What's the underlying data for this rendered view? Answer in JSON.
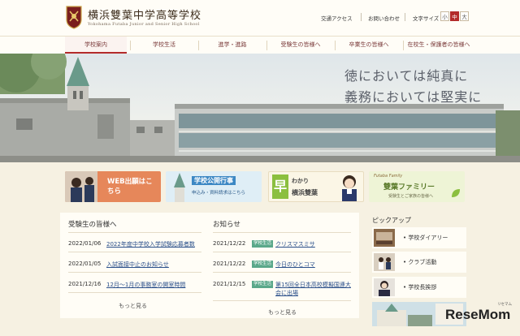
{
  "header": {
    "school_name": "横浜雙葉中学高等学校",
    "school_name_en": "Yokohama Futaba Junior and Senior High School",
    "utility_links": [
      "交通アクセス",
      "お問い合わせ"
    ],
    "font_size_label": "文字サイズ",
    "font_sizes": [
      "小",
      "中",
      "大"
    ],
    "font_size_selected": "中"
  },
  "nav": {
    "items": [
      "学校案内",
      "学校生活",
      "進学・進路",
      "受験生の皆様へ",
      "卒業生の皆様へ",
      "在校生・保護者の皆様へ"
    ],
    "active": "学校案内"
  },
  "hero": {
    "motto_line1": "徳においては純真に",
    "motto_line2": "義務においては堅実に"
  },
  "banners": {
    "web_application": "WEB出願はこちら",
    "school_events": "学校公開行事",
    "school_events_sub": "申込み・資料請求はこちら",
    "easy_futaba_1": "わかり",
    "easy_futaba_2": "横浜雙葉",
    "easy_futaba_big": "早",
    "family": "雙葉ファミリー",
    "family_en": "Futaba Family",
    "family_sub": "受験生とご家族の皆様へ"
  },
  "applicants": {
    "title": "受験生の皆様へ",
    "rows": [
      {
        "date": "2022/01/06",
        "text": "2022年度中学校入学試験応募者数"
      },
      {
        "date": "2022/01/05",
        "text": "入試面接中止のお知らせ"
      },
      {
        "date": "2021/12/16",
        "text": "12月～1月の事務室の開室時間"
      }
    ],
    "more": "もっと見る"
  },
  "news": {
    "title": "お知らせ",
    "rows": [
      {
        "date": "2021/12/22",
        "tag": "学校生活",
        "text": "クリスマスミサ"
      },
      {
        "date": "2021/12/22",
        "tag": "学校生活",
        "text": "今日のひとコマ"
      },
      {
        "date": "2021/12/15",
        "tag": "学校生活",
        "text": "第15回全日本高校模擬国連大会に出場"
      }
    ],
    "more": "もっと見る"
  },
  "pickup": {
    "title": "ピックアップ",
    "items": [
      "学校ダイアリー",
      "クラブ活動",
      "学校長挨拶"
    ]
  },
  "watermark": {
    "brand": "ReseMom",
    "brand_jp": "リセマム"
  },
  "colors": {
    "accent": "#b32b2b",
    "nav_text": "#7a3a3a",
    "tag_green": "#5aa88a",
    "link_blue": "#2a4f8a",
    "page_bg": "#f6f1e2"
  }
}
